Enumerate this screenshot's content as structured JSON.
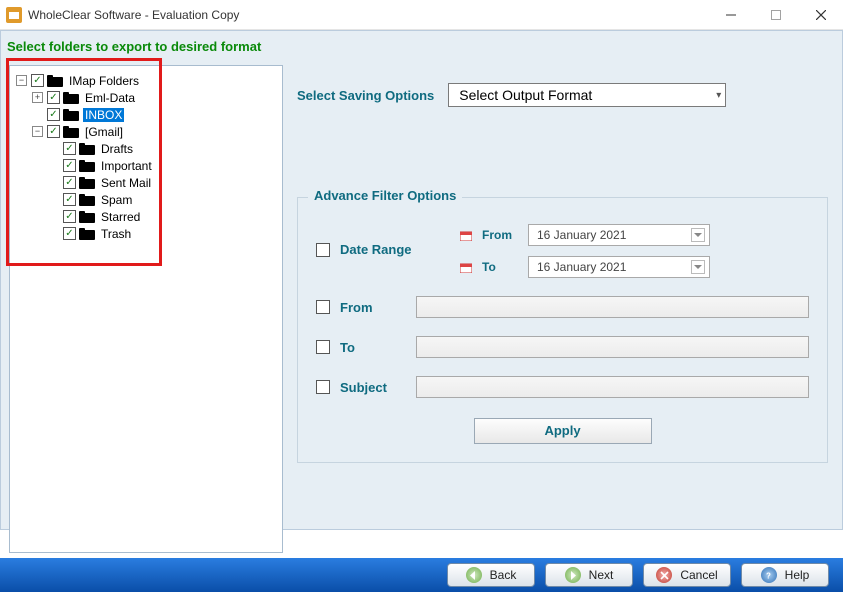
{
  "window": {
    "title": "WholeClear Software - Evaluation Copy"
  },
  "instruction": "Select folders to export to desired format",
  "tree": {
    "root": "IMap Folders",
    "eml": "Eml-Data",
    "inbox": "INBOX",
    "gmail": "[Gmail]",
    "drafts": "Drafts",
    "important": "Important",
    "sent": "Sent Mail",
    "spam": "Spam",
    "starred": "Starred",
    "trash": "Trash"
  },
  "saving": {
    "label": "Select Saving Options",
    "value": "Select Output Format"
  },
  "filter": {
    "legend": "Advance Filter Options",
    "dateRange": "Date Range",
    "fromSub": "From",
    "toSub": "To",
    "dateFrom": "16   January    2021",
    "dateTo": "16   January    2021",
    "from": "From",
    "to": "To",
    "subject": "Subject",
    "apply": "Apply"
  },
  "nav": {
    "back": "Back",
    "next": "Next",
    "cancel": "Cancel",
    "help": "Help"
  }
}
